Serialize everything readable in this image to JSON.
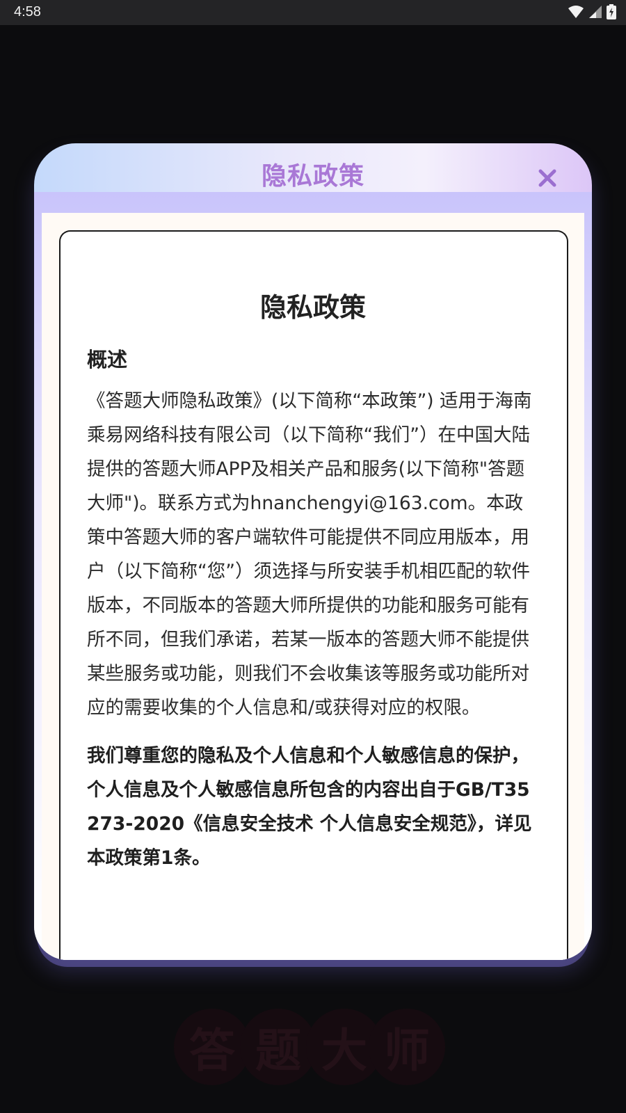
{
  "status_bar": {
    "time": "4:58",
    "icons": [
      "wifi-icon",
      "signal-icon",
      "battery-icon"
    ]
  },
  "dialog": {
    "title": "隐私政策",
    "close_label": "×",
    "document": {
      "title": "隐私政策",
      "section_heading": "概述",
      "paragraph_1": "《答题大师隐私政策》(以下简称“本政策”) 适用于海南乘易网络科技有限公司（以下简称“我们”）在中国大陆提供的答题大师APP及相关产品和服务(以下简称\"答题大师\")。联系方式为hnanchengyi@163.com。本政策中答题大师的客户端软件可能提供不同应用版本，用户（以下简称“您”）须选择与所安装手机相匹配的软件版本，不同版本的答题大师所提供的功能和服务可能有所不同，但我们承诺，若某一版本的答题大师不能提供某些服务或功能，则我们不会收集该等服务或功能所对应的需要收集的个人信息和/或获得对应的权限。",
      "paragraph_2": "我们尊重您的隐私及个人信息和个人敏感信息的保护，个人信息及个人敏感信息所包含的内容出自于GB/T35273-2020《信息安全技术 个人信息安全规范》，详见本政策第1条。"
    }
  },
  "background_logo": {
    "characters": [
      "答",
      "题",
      "大",
      "师"
    ]
  },
  "colors": {
    "title_purple": "#a978d6",
    "close_purple": "#9b6fd0",
    "backdrop": "#0c0c0e"
  }
}
